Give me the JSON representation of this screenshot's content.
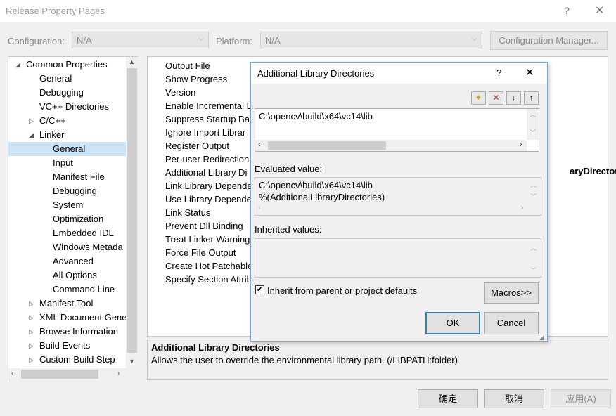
{
  "window": {
    "title": "Release Property Pages",
    "help": "?",
    "close": "✕"
  },
  "config": {
    "configuration_label": "Configuration:",
    "configuration_value": "N/A",
    "platform_label": "Platform:",
    "platform_value": "N/A",
    "manager_button": "Configuration Manager..."
  },
  "tree": [
    {
      "label": "Common Properties",
      "toggle": "◢",
      "indent": 0
    },
    {
      "label": "General",
      "toggle": "",
      "indent": 1
    },
    {
      "label": "Debugging",
      "toggle": "",
      "indent": 1
    },
    {
      "label": "VC++ Directories",
      "toggle": "",
      "indent": 1
    },
    {
      "label": "C/C++",
      "toggle": "▷",
      "indent": 1
    },
    {
      "label": "Linker",
      "toggle": "◢",
      "indent": 1
    },
    {
      "label": "General",
      "toggle": "",
      "indent": 2,
      "selected": true
    },
    {
      "label": "Input",
      "toggle": "",
      "indent": 2
    },
    {
      "label": "Manifest File",
      "toggle": "",
      "indent": 2
    },
    {
      "label": "Debugging",
      "toggle": "",
      "indent": 2
    },
    {
      "label": "System",
      "toggle": "",
      "indent": 2
    },
    {
      "label": "Optimization",
      "toggle": "",
      "indent": 2
    },
    {
      "label": "Embedded IDL",
      "toggle": "",
      "indent": 2
    },
    {
      "label": "Windows Metada",
      "toggle": "",
      "indent": 2
    },
    {
      "label": "Advanced",
      "toggle": "",
      "indent": 2
    },
    {
      "label": "All Options",
      "toggle": "",
      "indent": 2
    },
    {
      "label": "Command Line",
      "toggle": "",
      "indent": 2
    },
    {
      "label": "Manifest Tool",
      "toggle": "▷",
      "indent": 1
    },
    {
      "label": "XML Document Gene",
      "toggle": "▷",
      "indent": 1
    },
    {
      "label": "Browse Information",
      "toggle": "▷",
      "indent": 1
    },
    {
      "label": "Build Events",
      "toggle": "▷",
      "indent": 1
    },
    {
      "label": "Custom Build Step",
      "toggle": "▷",
      "indent": 1
    }
  ],
  "properties": [
    "Output File",
    "Show Progress",
    "Version",
    "Enable Incremental L",
    "Suppress Startup Bar",
    "Ignore Import Librar",
    "Register Output",
    "Per-user Redirection",
    "Additional Library Di",
    "Link Library Depende",
    "Use Library Depende",
    "Link Status",
    "Prevent Dll Binding",
    "Treat Linker Warning",
    "Force File Output",
    "Create Hot Patchable",
    "Specify Section Attrib"
  ],
  "property_value_fragment": "aryDirectories)",
  "description": {
    "title": "Additional Library Directories",
    "text": "Allows the user to override the environmental library path. (/LIBPATH:folder)"
  },
  "dialog": {
    "title": "Additional Library Directories",
    "help": "?",
    "close": "✕",
    "entries": [
      "C:\\opencv\\build\\x64\\vc14\\lib"
    ],
    "evaluated_label": "Evaluated value:",
    "evaluated_lines": [
      "C:\\opencv\\build\\x64\\vc14\\lib",
      "%(AdditionalLibraryDirectories)"
    ],
    "inherited_label": "Inherited values:",
    "inherit_checkbox_label": "Inherit from parent or project defaults",
    "inherit_checked": true,
    "macros_button": "Macros>>",
    "ok_button": "OK",
    "cancel_button": "Cancel"
  },
  "footer": {
    "ok": "确定",
    "cancel": "取消",
    "apply": "应用(A)"
  },
  "colors": {
    "selection": "#cde4f7",
    "focus_border": "#3c7fb1",
    "dialog_border": "#7aa6d6"
  }
}
